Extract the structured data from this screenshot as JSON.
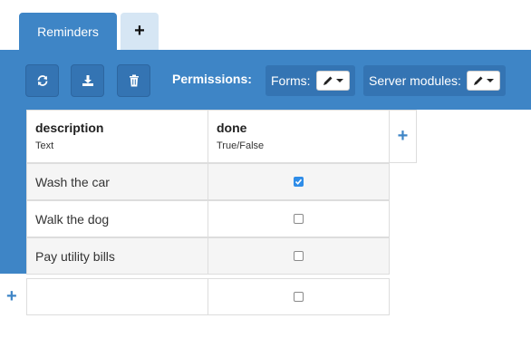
{
  "tabs": {
    "active_label": "Reminders",
    "add_label": "+"
  },
  "toolbar": {
    "permissions_label": "Permissions:",
    "forms_label": "Forms:",
    "server_modules_label": "Server modules:"
  },
  "columns": [
    {
      "name": "description",
      "type": "Text"
    },
    {
      "name": "done",
      "type": "True/False"
    }
  ],
  "add_column_label": "+",
  "rows": [
    {
      "description": "Wash the car",
      "done": true
    },
    {
      "description": "Walk the dog",
      "done": false
    },
    {
      "description": "Pay utility bills",
      "done": false
    }
  ],
  "new_row": {
    "description": "",
    "done": false
  },
  "add_row_label": "+",
  "colors": {
    "accent": "#3e85c6",
    "tab_inactive": "#d6e6f4",
    "checkbox_on": "#2f8de8"
  }
}
